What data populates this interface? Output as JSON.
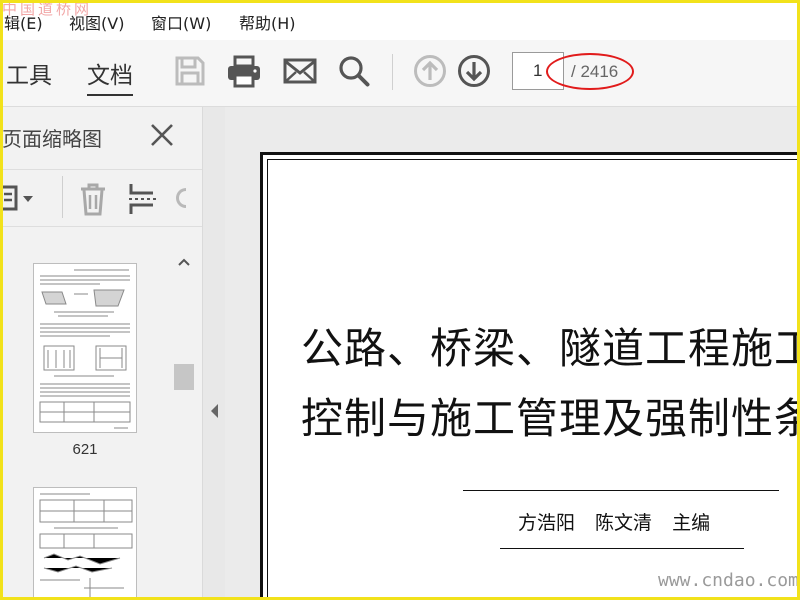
{
  "watermark_top": "中国道桥网",
  "watermark_bottom": "www.cndao.com",
  "menu": {
    "items": [
      "辑(E)",
      "视图(V)",
      "窗口(W)",
      "帮助(H)"
    ]
  },
  "toolbar": {
    "tabs": [
      "工具",
      "文档"
    ],
    "active_tab": "文档",
    "icons": [
      "save-icon",
      "print-icon",
      "mail-icon",
      "search-icon",
      "arrow-up-icon",
      "arrow-down-icon"
    ],
    "page_current": "1",
    "page_total": "/ 2416",
    "highlight_color": "#e11b1b"
  },
  "sidebar": {
    "title": "页面缩略图",
    "tools": [
      "page-options-icon",
      "delete-icon",
      "crop-icon"
    ],
    "thumbnails": [
      {
        "label": "621"
      },
      {
        "label": ""
      }
    ]
  },
  "document": {
    "title_line1": "公路、桥梁、隧道工程施工组",
    "title_line2": "控制与施工管理及强制性条文",
    "authors": "方浩阳 陈文清 主编"
  }
}
